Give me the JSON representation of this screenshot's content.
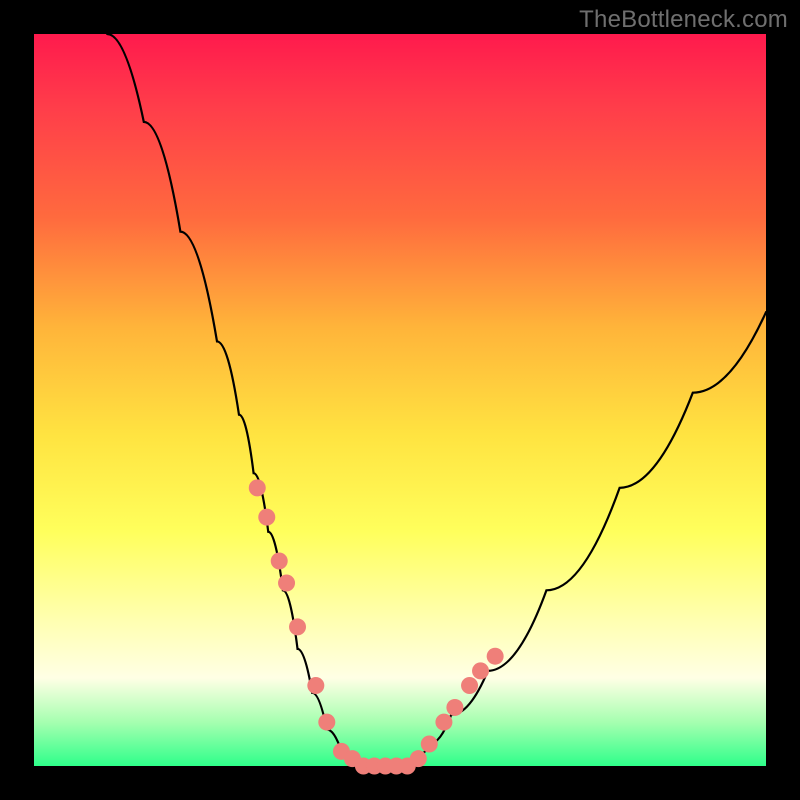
{
  "watermark": "TheBottleneck.com",
  "chart_data": {
    "type": "line",
    "title": "",
    "xlabel": "",
    "ylabel": "",
    "xlim": [
      0,
      100
    ],
    "ylim": [
      0,
      100
    ],
    "gradient_meaning": "red=high bottleneck, green=low bottleneck",
    "series": [
      {
        "name": "bottleneck-curve",
        "x": [
          10,
          15,
          20,
          25,
          28,
          30,
          32,
          34,
          36,
          38,
          40,
          42,
          44,
          46,
          48,
          50,
          52,
          54,
          57,
          62,
          70,
          80,
          90,
          100
        ],
        "values": [
          100,
          88,
          73,
          58,
          48,
          40,
          32,
          24,
          16,
          10,
          5,
          2,
          1,
          0,
          0,
          0,
          1,
          3,
          7,
          13,
          24,
          38,
          51,
          62
        ]
      }
    ],
    "markers": {
      "name": "sample-dots",
      "color": "#ef7f79",
      "x": [
        30.5,
        31.8,
        33.5,
        34.5,
        36.0,
        38.5,
        40.0,
        42.0,
        43.5,
        45.0,
        46.5,
        48.0,
        49.5,
        51.0,
        52.5,
        54.0,
        56.0,
        57.5,
        59.5,
        61.0,
        63.0
      ],
      "values": [
        38,
        34,
        28,
        25,
        19,
        11,
        6,
        2,
        1,
        0,
        0,
        0,
        0,
        0,
        1,
        3,
        6,
        8,
        11,
        13,
        15
      ]
    }
  }
}
